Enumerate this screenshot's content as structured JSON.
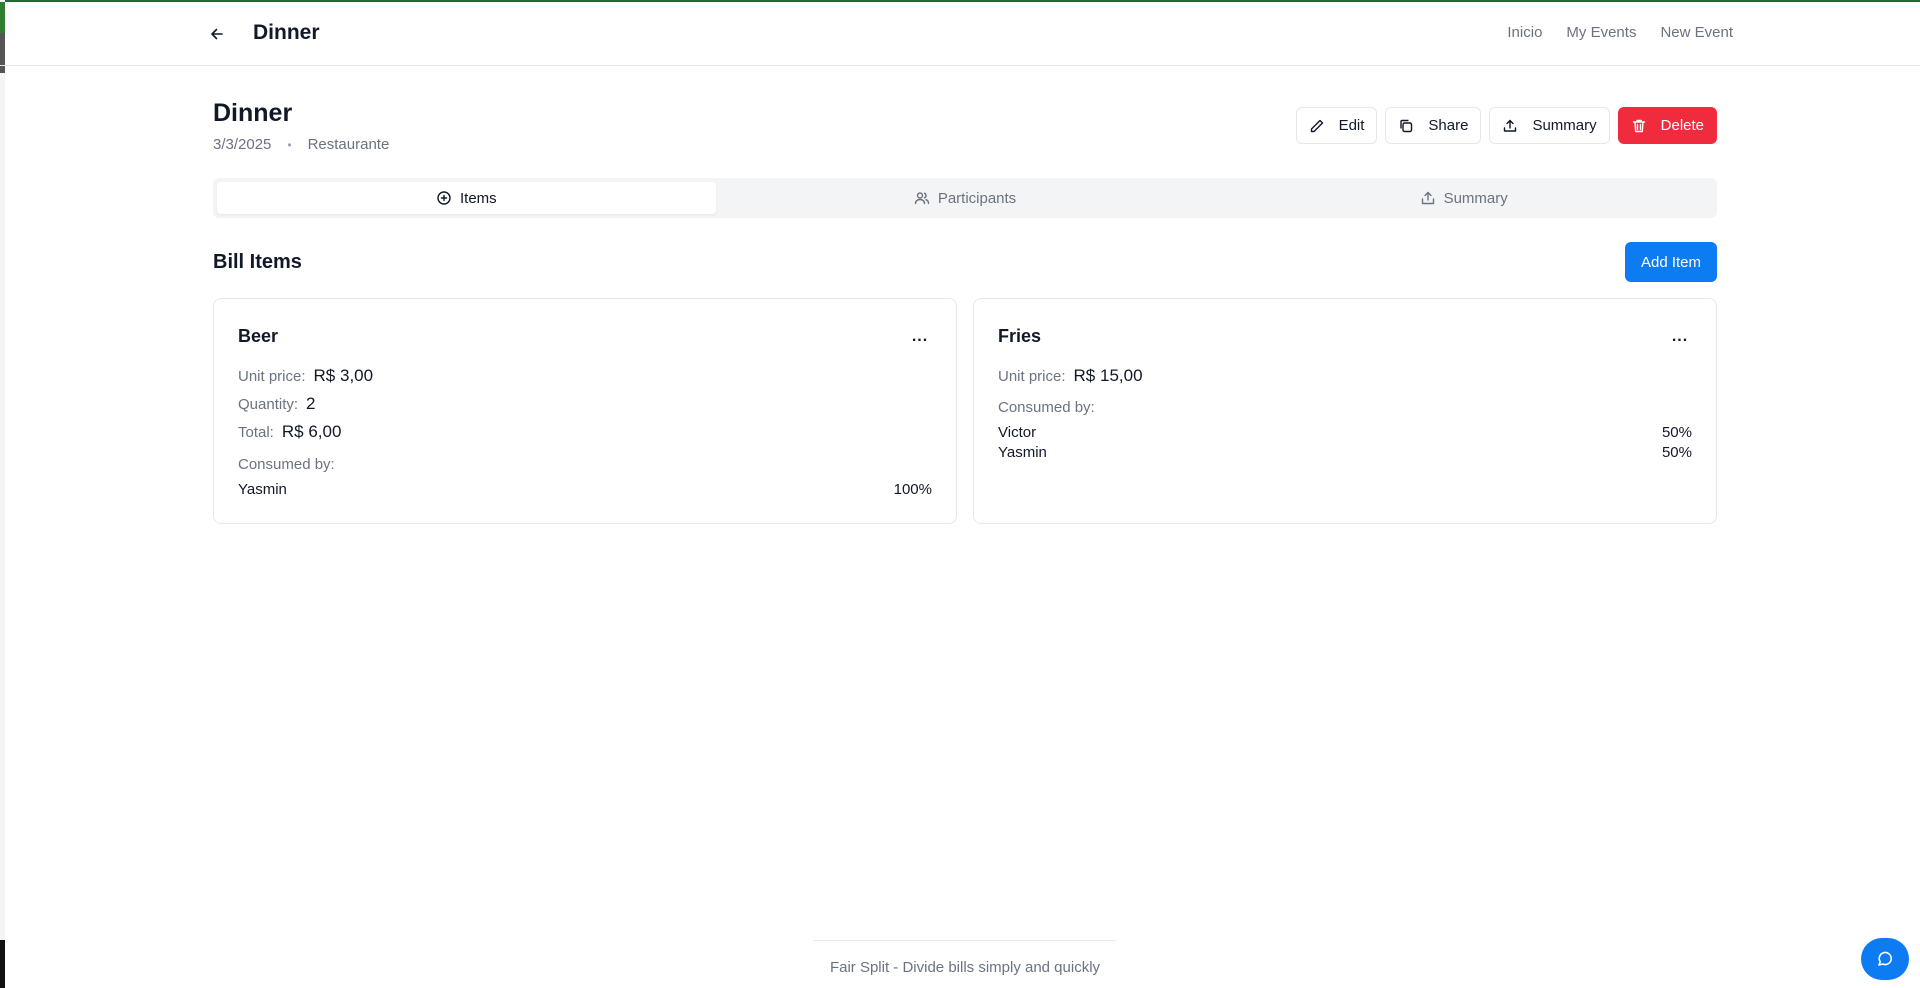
{
  "header": {
    "title": "Dinner",
    "nav": {
      "home": "Inicio",
      "my_events": "My Events",
      "new_event": "New Event"
    }
  },
  "event": {
    "title": "Dinner",
    "date": "3/3/2025",
    "separator": "•",
    "category": "Restaurante"
  },
  "actions": {
    "edit": "Edit",
    "share": "Share",
    "summary": "Summary",
    "delete": "Delete"
  },
  "tabs": [
    {
      "label": "Items",
      "icon": "plus-circle-icon",
      "active": true
    },
    {
      "label": "Participants",
      "icon": "users-icon",
      "active": false
    },
    {
      "label": "Summary",
      "icon": "share-upload-icon",
      "active": false
    }
  ],
  "section": {
    "title": "Bill Items",
    "add_label": "Add Item"
  },
  "items": [
    {
      "name": "Beer",
      "unit_price_label": "Unit price:",
      "unit_price": "R$ 3,00",
      "quantity_label": "Quantity:",
      "quantity": "2",
      "total_label": "Total:",
      "total": "R$ 6,00",
      "consumed_label": "Consumed by:",
      "consumers": [
        {
          "name": "Yasmin",
          "share": "100%"
        }
      ],
      "menu": "..."
    },
    {
      "name": "Fries",
      "unit_price_label": "Unit price:",
      "unit_price": "R$ 15,00",
      "consumed_label": "Consumed by:",
      "consumers": [
        {
          "name": "Victor",
          "share": "50%"
        },
        {
          "name": "Yasmin",
          "share": "50%"
        }
      ],
      "menu": "..."
    }
  ],
  "footer": {
    "text": "Fair Split - Divide bills simply and quickly"
  },
  "colors": {
    "primary": "#0d7cf2",
    "danger": "#ef2b3d",
    "muted": "#6b7280",
    "border": "#e5e7eb"
  },
  "icons": {
    "back": "arrow-left-icon",
    "edit": "pencil-icon",
    "share": "copy-icon",
    "summary": "upload-icon",
    "delete": "trash-icon",
    "chat": "chat-bubble-icon"
  }
}
